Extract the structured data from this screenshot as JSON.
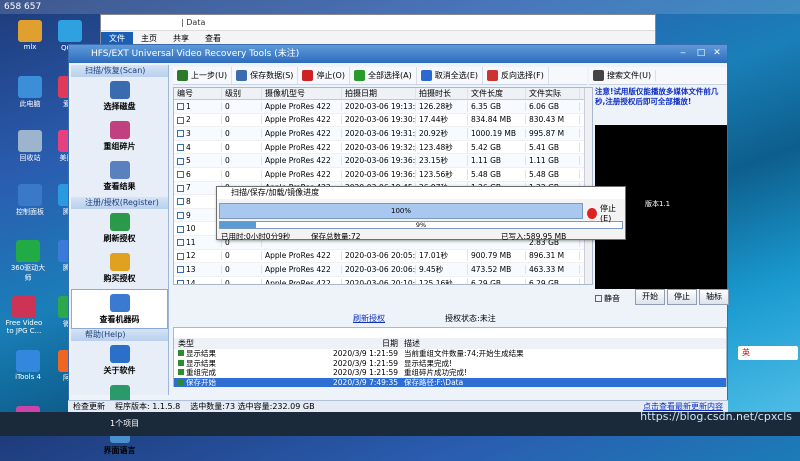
{
  "desktop": {
    "top_text": "658 657",
    "icons": [
      {
        "label": "mlx",
        "color": "#e0a030"
      },
      {
        "label": "QQ音",
        "color": "#2fa0e0"
      },
      {
        "label": "此电脑",
        "color": "#3a8fd8"
      },
      {
        "label": "爱剪",
        "color": "#e03a5a"
      },
      {
        "label": "回收站",
        "color": "#9cb5cc"
      },
      {
        "label": "美图秀",
        "color": "#e64080"
      },
      {
        "label": "控制面板",
        "color": "#3a78c8"
      },
      {
        "label": "腾讯",
        "color": "#2a9ae0"
      },
      {
        "label": "360驱动大师",
        "color": "#22aa44"
      },
      {
        "label": "腾讯",
        "color": "#3a7ad8"
      },
      {
        "label": "Free Video to JPG C...",
        "color": "#cc3355"
      },
      {
        "label": "微信",
        "color": "#2aa84a"
      },
      {
        "label": "iTools 4",
        "color": "#3388dd"
      },
      {
        "label": "阿里",
        "color": "#ee6622"
      },
      {
        "label": "iTunes",
        "color": "#cc44aa"
      }
    ]
  },
  "explorer": {
    "path": "| Data",
    "tabs": [
      "文件",
      "主页",
      "共享",
      "查看"
    ]
  },
  "app": {
    "title": "HFS/EXT Universal Video Recovery Tools (未注)",
    "sidebar": {
      "scan_header": "扫描/恢复(Scan)",
      "scan_items": [
        "选择磁盘",
        "重组碎片",
        "查看结果"
      ],
      "register_header": "注册/授权(Register)",
      "register_items": [
        "刷新授权",
        "购买授权",
        "查看机器码"
      ],
      "help_header": "帮助(Help)",
      "help_items": [
        "关于软件",
        "访问网站",
        "界面语言"
      ]
    },
    "toolbar": [
      {
        "label": "上一步(U)",
        "color": "#2a7a2a"
      },
      {
        "label": "保存数据(S)",
        "color": "#3a6ab0"
      },
      {
        "label": "停止(O)",
        "color": "#cc2222"
      },
      {
        "label": "全部选择(A)",
        "color": "#2a9a2a"
      },
      {
        "label": "取消全选(E)",
        "color": "#2a6ad0"
      },
      {
        "label": "反向选择(F)",
        "color": "#cc3333"
      }
    ],
    "search_button": "搜索文件(U)",
    "table": {
      "headers": [
        "编号",
        "级别",
        "摄像机型号",
        "拍摄日期",
        "拍摄时长",
        "文件长度",
        "文件实际"
      ],
      "rows": [
        [
          "1",
          "0",
          "Apple ProRes 422",
          "2020-03-06 19:13:57",
          "126.28秒",
          "6.35 GB",
          "6.06 GB"
        ],
        [
          "2",
          "0",
          "Apple ProRes 422",
          "2020-03-06 19:30:49",
          "17.44秒",
          "834.84 MB",
          "830.43 M"
        ],
        [
          "3",
          "0",
          "Apple ProRes 422",
          "2020-03-06 19:31:20",
          "20.92秒",
          "1000.19 MB",
          "995.87 M"
        ],
        [
          "4",
          "0",
          "Apple ProRes 422",
          "2020-03-06 19:32:17",
          "123.48秒",
          "5.42 GB",
          "5.41 GB"
        ],
        [
          "5",
          "0",
          "Apple ProRes 422",
          "2020-03-06 19:36:02",
          "23.15秒",
          "1.11 GB",
          "1.11 GB"
        ],
        [
          "6",
          "0",
          "Apple ProRes 422",
          "2020-03-06 19:36:59",
          "123.56秒",
          "5.48 GB",
          "5.48 GB"
        ],
        [
          "7",
          "0",
          "Apple ProRes 422",
          "2020-03-06 19:45:01",
          "26.97秒",
          "1.26 GB",
          "1.22 GB"
        ],
        [
          "8",
          "0",
          "",
          "",
          "",
          "",
          "1.05 GB"
        ],
        [
          "9",
          "0",
          "",
          "",
          "",
          "",
          "955.57 M"
        ],
        [
          "10",
          "0",
          "",
          "",
          "",
          "",
          "6.17 GB"
        ],
        [
          "11",
          "0",
          "",
          "",
          "",
          "",
          "2.83 GB"
        ],
        [
          "12",
          "0",
          "Apple ProRes 422",
          "2020-03-06 20:05:22",
          "17.01秒",
          "900.79 MB",
          "896.31 M"
        ],
        [
          "13",
          "0",
          "Apple ProRes 422",
          "2020-03-06 20:06:36",
          "9.45秒",
          "473.52 MB",
          "463.33 M"
        ],
        [
          "14",
          "0",
          "Apple ProRes 422",
          "2020-03-06 20:10:02",
          "125.16秒",
          "6.29 GB",
          "6.29 GB"
        ],
        [
          "15",
          "0",
          "Apple ProRes 422",
          "2020-03-06 20:30:13",
          "1.28秒",
          "65.91 MB",
          "65.91 MB"
        ],
        [
          "16",
          "0",
          "Apple ProRes 422",
          "2020-03-06 20:34:23",
          "124.60秒",
          "6.45 GB",
          "6.29 GB"
        ]
      ]
    },
    "notice": "注意!试用版仅能播放多媒体文件前几秒,注册授权后即可全部播放!",
    "preview_version": "版本1.1",
    "mute_label": "静音",
    "player_buttons": [
      "开始",
      "停止",
      "轴标"
    ],
    "refresh_auth": "刷新授权",
    "auth_status": "授权状态:未注",
    "log": {
      "title": "日志",
      "headers": [
        "类型",
        "日期",
        "描述"
      ],
      "rows": [
        {
          "type": "显示结果",
          "date": "2020/3/9 1:21:59",
          "desc": "当前重组文件数量:74;开始生成结果"
        },
        {
          "type": "显示结果",
          "date": "2020/3/9 1:21:59",
          "desc": "显示结果完成!"
        },
        {
          "type": "重组完成",
          "date": "2020/3/9 1:21:59",
          "desc": "重组碎片成功完成!"
        },
        {
          "type": "保存开始",
          "date": "2020/3/9 7:49:35",
          "desc": "保存路径:F:\\Data"
        }
      ]
    },
    "status": {
      "check_update": "检查更新",
      "version": "程序版本: 1.1.5.8",
      "selection": "选中数量:73 选中容量:232.09 GB",
      "update_link": "点击查看最新更新内容"
    }
  },
  "dialog": {
    "title": "扫描/保存/加载/镜像进度",
    "bar1_pct": 100,
    "bar1_label": "100%",
    "bar2_pct": 9,
    "bar2_label": "9%",
    "stop_label": "停止(E)",
    "elapsed": "已用时:0小时0分9秒",
    "saved_total": "保存总数量:72",
    "written": "已写入:589.95 MB"
  },
  "taskbar_text": "1个项目",
  "watermark": "https://blog.csdn.net/cpxcls",
  "ime": "英"
}
